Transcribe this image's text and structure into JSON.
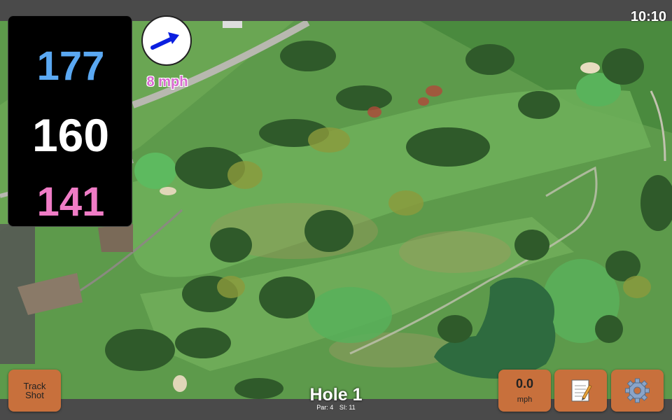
{
  "clock": "10:10",
  "yardage": {
    "back": "177",
    "middle": "160",
    "front": "141"
  },
  "wind": {
    "speed": "8 mph",
    "icon": "wind-direction-arrow-icon"
  },
  "buttons": {
    "track_shot_line1": "Track",
    "track_shot_line2": "Shot",
    "speed_value": "0.0",
    "speed_unit": "mph",
    "notes_icon": "notepad-icon",
    "settings_icon": "gear-icon"
  },
  "hole": {
    "title": "Hole 1",
    "par": "Par: 4",
    "si": "SI: 11"
  },
  "colors": {
    "back_yardage": "#5aa8f2",
    "middle_yardage": "#ffffff",
    "front_yardage": "#f07cc6",
    "button": "#c8703c",
    "bar": "#4a4a4a"
  }
}
